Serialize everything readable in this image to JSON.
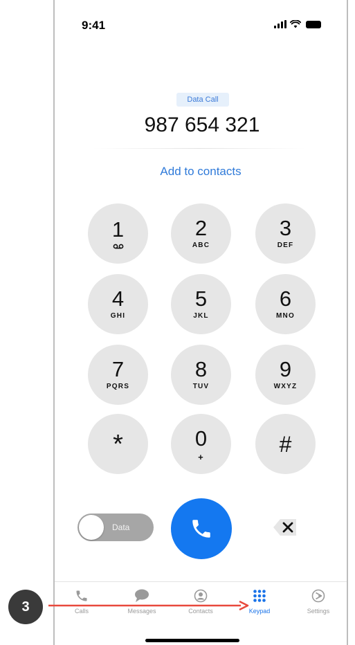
{
  "status_bar": {
    "time": "9:41"
  },
  "dialer": {
    "call_type": "Data Call",
    "number": "987 654 321",
    "add_to_contacts": "Add to contacts"
  },
  "keypad": [
    {
      "digit": "1",
      "letters": "",
      "icon": "voicemail-icon"
    },
    {
      "digit": "2",
      "letters": "ABC"
    },
    {
      "digit": "3",
      "letters": "DEF"
    },
    {
      "digit": "4",
      "letters": "GHI"
    },
    {
      "digit": "5",
      "letters": "JKL"
    },
    {
      "digit": "6",
      "letters": "MNO"
    },
    {
      "digit": "7",
      "letters": "PQRS"
    },
    {
      "digit": "8",
      "letters": "TUV"
    },
    {
      "digit": "9",
      "letters": "WXYZ"
    },
    {
      "digit": "*",
      "letters": ""
    },
    {
      "digit": "0",
      "letters": "+"
    },
    {
      "digit": "#",
      "letters": ""
    }
  ],
  "controls": {
    "data_toggle_label": "Data",
    "data_toggle_on": false,
    "call_button_icon": "phone-icon",
    "backspace_icon": "backspace-icon"
  },
  "tabs": [
    {
      "label": "Calls",
      "icon": "phone-icon",
      "active": false
    },
    {
      "label": "Messages",
      "icon": "chat-bubble-icon",
      "active": false
    },
    {
      "label": "Contacts",
      "icon": "person-circle-icon",
      "active": false
    },
    {
      "label": "Keypad",
      "icon": "keypad-grid-icon",
      "active": true
    },
    {
      "label": "Settings",
      "icon": "settings-icon",
      "active": false
    }
  ],
  "annotation": {
    "step_number": "3"
  },
  "colors": {
    "accent": "#1478f0",
    "link": "#2f7ad9",
    "key_background": "#e6e6e6",
    "annotation_arrow": "#e8493c",
    "badge": "#3a3a3a"
  }
}
